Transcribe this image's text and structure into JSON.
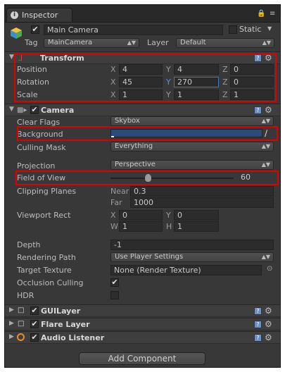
{
  "window": {
    "tab_title": "Inspector"
  },
  "object": {
    "name": "Main Camera",
    "static_label": "Static",
    "tag_label": "Tag",
    "tag_value": "MainCamera",
    "layer_label": "Layer",
    "layer_value": "Default"
  },
  "transform": {
    "title": "Transform",
    "position": {
      "label": "Position",
      "x": "4",
      "y": "4",
      "z": "0"
    },
    "rotation": {
      "label": "Rotation",
      "x": "45",
      "y": "270",
      "z": "0"
    },
    "scale": {
      "label": "Scale",
      "x": "1",
      "y": "1",
      "z": "1"
    }
  },
  "axes": {
    "x": "X",
    "y": "Y",
    "z": "Z"
  },
  "camera": {
    "title": "Camera",
    "clear_flags": {
      "label": "Clear Flags",
      "value": "Skybox"
    },
    "background": {
      "label": "Background",
      "color": "#2c4a7a"
    },
    "culling_mask": {
      "label": "Culling Mask",
      "value": "Everything"
    },
    "projection": {
      "label": "Projection",
      "value": "Perspective"
    },
    "fov": {
      "label": "Field of View",
      "value": "60",
      "fraction": 0.3
    },
    "clipping": {
      "label": "Clipping Planes",
      "near_label": "Near",
      "near": "0.3",
      "far_label": "Far",
      "far": "1000"
    },
    "viewport": {
      "label": "Viewport Rect",
      "x_label": "X",
      "x": "0",
      "y_label": "Y",
      "y": "0",
      "w_label": "W",
      "w": "1",
      "h_label": "H",
      "h": "1"
    },
    "depth": {
      "label": "Depth",
      "value": "-1"
    },
    "rendering_path": {
      "label": "Rendering Path",
      "value": "Use Player Settings"
    },
    "target_texture": {
      "label": "Target Texture",
      "value": "None (Render Texture)"
    },
    "occlusion": {
      "label": "Occlusion Culling"
    },
    "hdr": {
      "label": "HDR"
    }
  },
  "components": {
    "gui_layer": "GUILayer",
    "flare_layer": "Flare Layer",
    "audio_listener": "Audio Listener"
  },
  "add_component": "Add Component",
  "colors": {
    "highlight": "#e00000",
    "focus": "#3d76c7"
  }
}
